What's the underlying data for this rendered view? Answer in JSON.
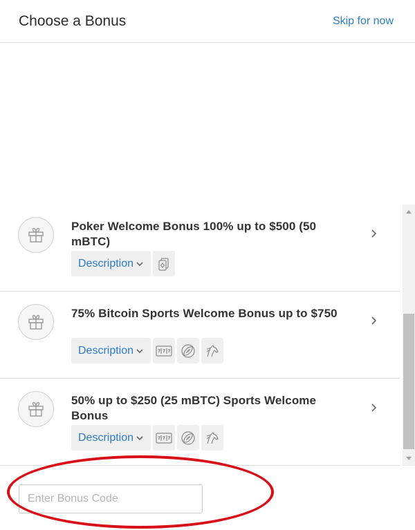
{
  "header": {
    "title": "Choose a Bonus",
    "skip_label": "Skip for now"
  },
  "bonuses": [
    {
      "title": "Poker Welcome Bonus 100% up to $500 (50 mBTC)",
      "description_label": "Description",
      "tags": [
        "poker-cards-icon"
      ]
    },
    {
      "title": "75% Bitcoin Sports Welcome Bonus up to $750",
      "description_label": "Description",
      "tags": [
        "slot-machine-icon",
        "football-icon",
        "horse-racing-icon"
      ]
    },
    {
      "title": "50% up to $250 (25 mBTC) Sports Welcome Bonus",
      "description_label": "Description",
      "tags": [
        "slot-machine-icon",
        "football-icon",
        "horse-racing-icon"
      ]
    }
  ],
  "bonus_code": {
    "placeholder": "Enter Bonus Code",
    "value": ""
  },
  "colors": {
    "link": "#2c7cc7",
    "annotation": "#d90f17",
    "tag_background": "#efefef"
  }
}
